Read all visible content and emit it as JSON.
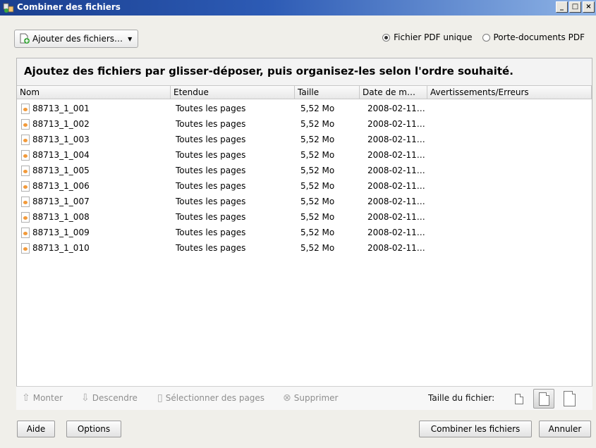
{
  "window": {
    "title": "Combiner des fichiers"
  },
  "window_buttons": {
    "minimize": "_",
    "maximize": "□",
    "close": "×"
  },
  "toolbar": {
    "add_files_label": "Ajouter des fichiers…",
    "radio_single_pdf": "Fichier PDF unique",
    "radio_portfolio": "Porte-documents PDF",
    "selected_radio": "Fichier PDF unique"
  },
  "instruction": "Ajoutez des fichiers par glisser-déposer, puis organisez-les selon l'ordre souhaité.",
  "columns": [
    "Nom",
    "Etendue",
    "Taille",
    "Date de m…",
    "Avertissements/Erreurs"
  ],
  "files": [
    {
      "name": "88713_1_001",
      "range": "Toutes les pages",
      "size": "5,52 Mo",
      "date": "2008-02-11…",
      "warnings": ""
    },
    {
      "name": "88713_1_002",
      "range": "Toutes les pages",
      "size": "5,52 Mo",
      "date": "2008-02-11…",
      "warnings": ""
    },
    {
      "name": "88713_1_003",
      "range": "Toutes les pages",
      "size": "5,52 Mo",
      "date": "2008-02-11…",
      "warnings": ""
    },
    {
      "name": "88713_1_004",
      "range": "Toutes les pages",
      "size": "5,52 Mo",
      "date": "2008-02-11…",
      "warnings": ""
    },
    {
      "name": "88713_1_005",
      "range": "Toutes les pages",
      "size": "5,52 Mo",
      "date": "2008-02-11…",
      "warnings": ""
    },
    {
      "name": "88713_1_006",
      "range": "Toutes les pages",
      "size": "5,52 Mo",
      "date": "2008-02-11…",
      "warnings": ""
    },
    {
      "name": "88713_1_007",
      "range": "Toutes les pages",
      "size": "5,52 Mo",
      "date": "2008-02-11…",
      "warnings": ""
    },
    {
      "name": "88713_1_008",
      "range": "Toutes les pages",
      "size": "5,52 Mo",
      "date": "2008-02-11…",
      "warnings": ""
    },
    {
      "name": "88713_1_009",
      "range": "Toutes les pages",
      "size": "5,52 Mo",
      "date": "2008-02-11…",
      "warnings": ""
    },
    {
      "name": "88713_1_010",
      "range": "Toutes les pages",
      "size": "5,52 Mo",
      "date": "2008-02-11…",
      "warnings": ""
    }
  ],
  "list_tools": {
    "move_up": "Monter",
    "move_down": "Descendre",
    "select_pages": "Sélectionner des pages",
    "delete": "Supprimer",
    "file_size_label": "Taille du fichier:",
    "selected_size": "medium"
  },
  "footer": {
    "help": "Aide",
    "options": "Options",
    "combine": "Combiner les fichiers",
    "cancel": "Annuler"
  },
  "icons": {
    "app": "combine-files-icon",
    "add": "add-files-icon",
    "file": "pdf-file-icon"
  }
}
